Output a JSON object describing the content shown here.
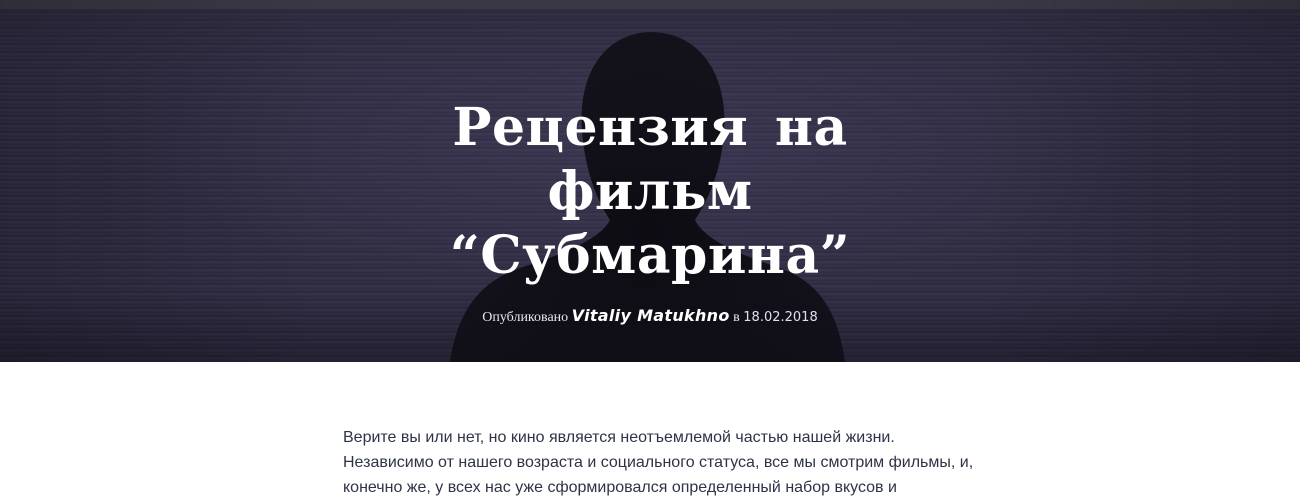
{
  "hero": {
    "title": "Рецензия на фильм “Субмарина”",
    "meta_prefix": "Опубликовано",
    "author": "Vitaliy Matukhno",
    "meta_in": "в",
    "date": "18.02.2018"
  },
  "article": {
    "paragraph": "Верите вы или нет, но кино является неотъемлемой частью нашей жизни. Независимо от нашего возраста и социального статуса, все мы смотрим фильмы, и, конечно же, у всех нас уже сформировался определенный набор вкусов и"
  },
  "colors": {
    "hero_bg": "#2f2c40",
    "text": "#2e3446",
    "title": "#ffffff"
  }
}
